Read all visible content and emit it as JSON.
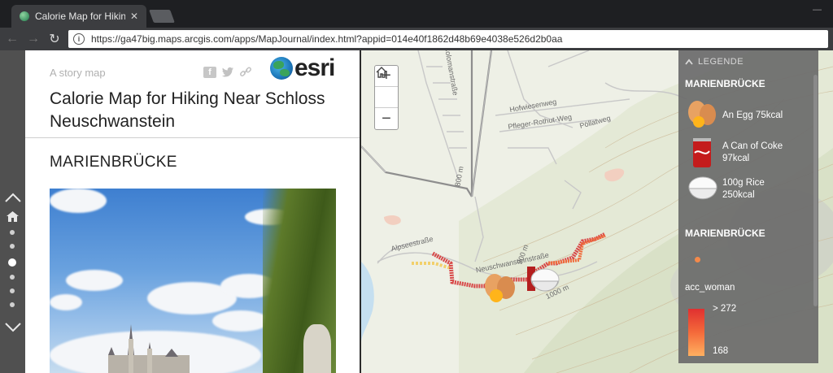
{
  "browser": {
    "tab_title": "Calorie Map for Hiking N",
    "tab_close": "✕",
    "url": "https://ga47big.maps.arcgis.com/apps/MapJournal/index.html?appid=014e40f1862d48b69e4038e526d2b0aa",
    "window_controls": "—"
  },
  "story": {
    "label": "A story map",
    "brand": "esri",
    "title": "Calorie Map for Hiking Near Schloss Neuschwanstein",
    "section_title": "MARIENBRÜCKE",
    "share_facebook": "f"
  },
  "map": {
    "zoom_in": "+",
    "zoom_out": "−",
    "street_labels": [
      "Hofwiesenweg",
      "Pfleger-Rothut-Weg",
      "Pöllatweg",
      "Alpseestraße",
      "Neuschwansteinstraße",
      "900 m",
      "1000 m",
      "800 m",
      "Colomanstraße"
    ]
  },
  "legend": {
    "header": "LEGENDE",
    "section1": "MARIENBRÜCKE",
    "items": [
      {
        "label_line1": "An Egg 75kcal",
        "label_line2": "",
        "icon": "egg-icon"
      },
      {
        "label_line1": "A Can of Coke",
        "label_line2": "97kcal",
        "icon": "coke-can-icon"
      },
      {
        "label_line1": "100g Rice",
        "label_line2": "250kcal",
        "icon": "rice-bowl-icon"
      }
    ],
    "section2": "MARIENBRÜCKE",
    "field": "acc_woman",
    "ramp_max": "> 272",
    "ramp_min": "168",
    "colors": {
      "ramp_high": "#e03030",
      "ramp_low": "#ffb060",
      "route": "#d84848"
    }
  }
}
